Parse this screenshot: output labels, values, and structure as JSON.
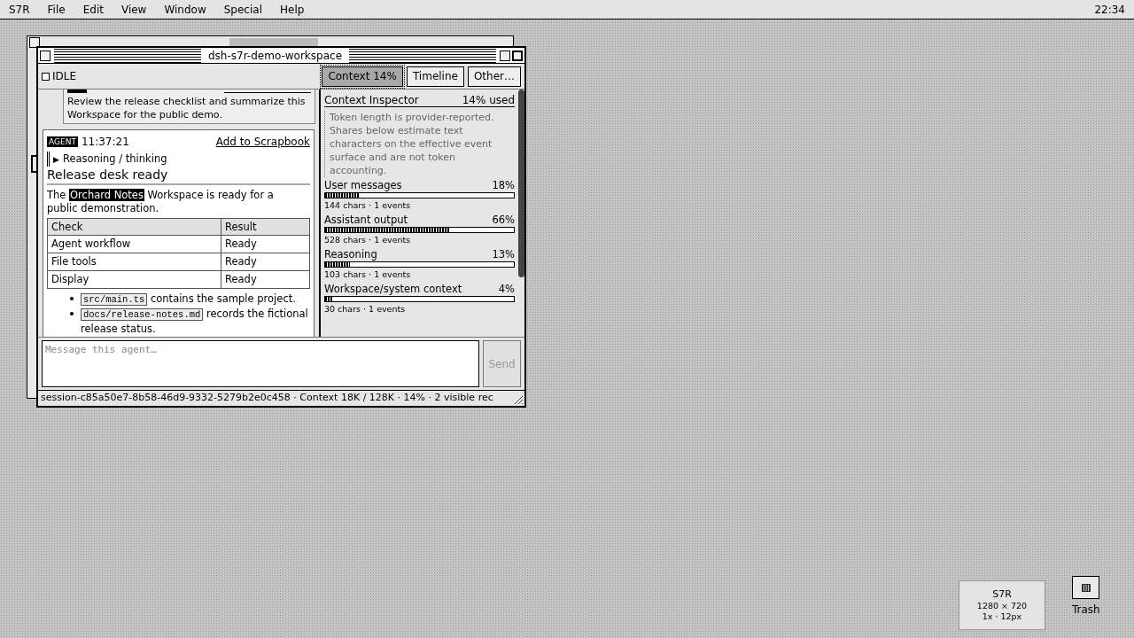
{
  "menu_bar": {
    "app": "S7R",
    "items": [
      "File",
      "Edit",
      "View",
      "Window",
      "Special",
      "Help"
    ],
    "clock": "22:34"
  },
  "back_window": {
    "kind": "window"
  },
  "window": {
    "title": "dsh-s7r-demo-workspace",
    "status": {
      "label": "IDLE",
      "checked": false
    },
    "tabs": [
      {
        "label": "Context 14%",
        "selected": true
      },
      {
        "label": "Timeline",
        "selected": false
      },
      {
        "label": "Other…",
        "selected": false
      }
    ],
    "messages": [
      {
        "kind": "user",
        "text": "Review the release checklist and summarize this Workspace for the public demo."
      },
      {
        "kind": "agent",
        "badge": "AGENT",
        "time": "11:37:21",
        "action": "Add to Scrapbook",
        "reasoning": {
          "marker": "▶",
          "label": "Reasoning / thinking"
        },
        "heading": "Release desk ready",
        "paragraph": {
          "before": "The",
          "highlight": "Orchard Notes",
          "after": "Workspace is ready for a public demonstration."
        },
        "table": {
          "columns": [
            "Check",
            "Result"
          ],
          "rows": [
            [
              "Agent workflow",
              "Ready"
            ],
            [
              "File tools",
              "Ready"
            ],
            [
              "Display",
              "Ready"
            ]
          ]
        },
        "bullets": [
          {
            "code": "src/main.ts",
            "text": "contains the sample project."
          },
          {
            "code": "docs/release-notes.md",
            "text": "records the fictional release status."
          }
        ]
      }
    ],
    "inspector": {
      "title": "Context Inspector",
      "usage": "14% used",
      "note": "Token length is provider-reported. Shares below estimate text characters on the effective event surface and are not token accounting.",
      "categories": [
        {
          "name": "User messages",
          "percent": "18%",
          "level": 0.18,
          "detail": "144 chars · 1 events"
        },
        {
          "name": "Assistant output",
          "percent": "66%",
          "level": 0.66,
          "detail": "528 chars · 1 events"
        },
        {
          "name": "Reasoning",
          "percent": "13%",
          "level": 0.13,
          "detail": "103 chars · 1 events"
        },
        {
          "name": "Workspace/system context",
          "percent": "4%",
          "level": 0.04,
          "detail": "30 chars · 1 events"
        }
      ]
    },
    "composer": {
      "placeholder": "Message this agent…",
      "send": "Send",
      "disabled": true
    },
    "status_bar": "session-c85a50e7-8b58-46d9-9332-5279b2e0c458 · Context 18K / 128K · 14% · 2 visible rec"
  },
  "desktop": {
    "info": {
      "title": "S7R",
      "resolution": "1280 × 720",
      "scale": "1x · 12px"
    },
    "trash": "Trash"
  }
}
